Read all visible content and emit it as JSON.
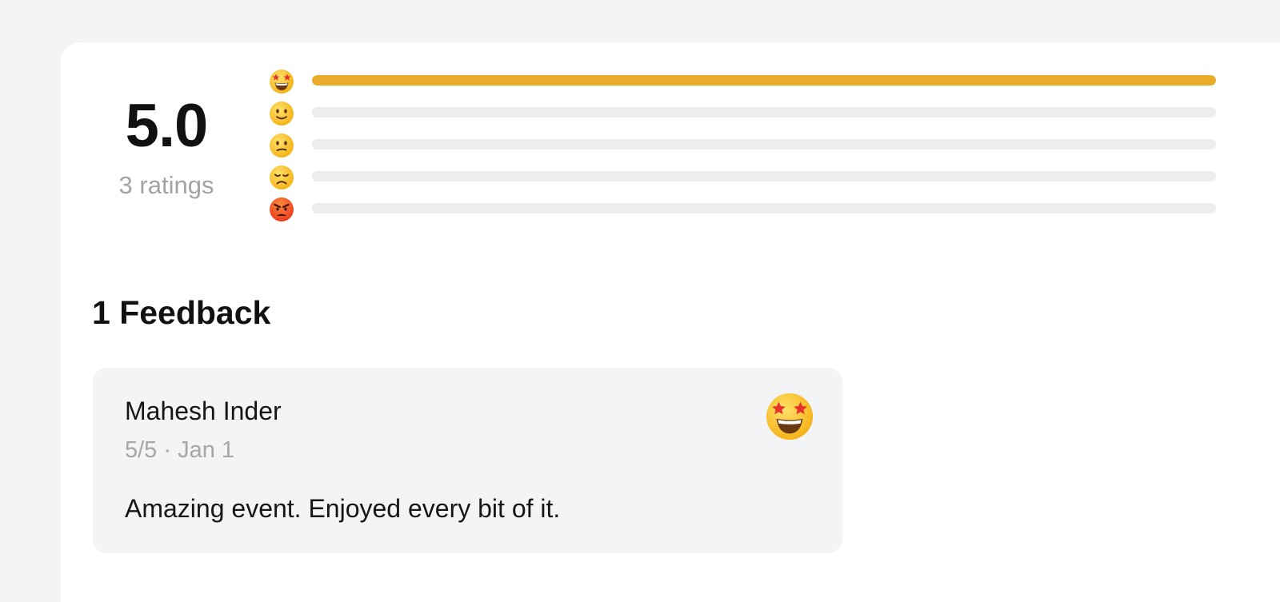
{
  "summary": {
    "average": "5.0",
    "count_label": "3 ratings"
  },
  "distribution": [
    {
      "icon": "star-struck-face-icon",
      "fraction": 1.0
    },
    {
      "icon": "slightly-smiling-face-icon",
      "fraction": 0.0
    },
    {
      "icon": "confused-face-icon",
      "fraction": 0.0
    },
    {
      "icon": "disappointed-face-icon",
      "fraction": 0.0
    },
    {
      "icon": "angry-face-icon",
      "fraction": 0.0
    }
  ],
  "feedback": {
    "title": "1 Feedback",
    "items": [
      {
        "name": "Mahesh Inder",
        "meta": "5/5 · Jan 1",
        "text": "Amazing event. Enjoyed every bit of it.",
        "icon": "star-struck-face-icon"
      }
    ]
  },
  "colors": {
    "page_bg": "#f3f4f6",
    "bar_fill": "#e8ab2a",
    "bar_track": "#ededed",
    "muted_text": "#a3a3a3"
  }
}
